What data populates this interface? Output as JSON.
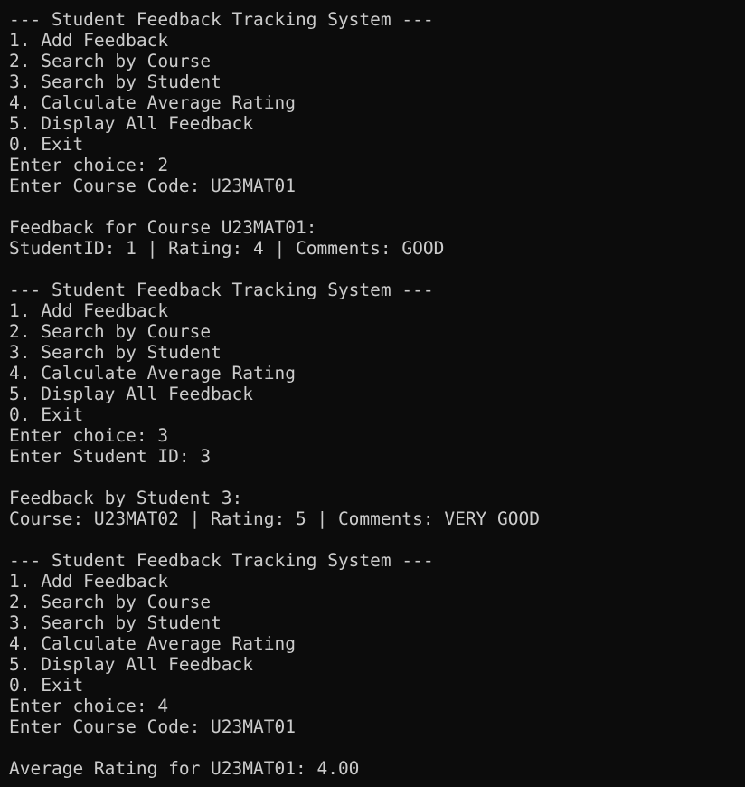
{
  "terminal": {
    "lines": [
      "--- Student Feedback Tracking System ---",
      "1. Add Feedback",
      "2. Search by Course",
      "3. Search by Student",
      "4. Calculate Average Rating",
      "5. Display All Feedback",
      "0. Exit",
      "Enter choice: 2",
      "Enter Course Code: U23MAT01",
      "",
      "Feedback for Course U23MAT01:",
      "StudentID: 1 | Rating: 4 | Comments: GOOD",
      "",
      "--- Student Feedback Tracking System ---",
      "1. Add Feedback",
      "2. Search by Course",
      "3. Search by Student",
      "4. Calculate Average Rating",
      "5. Display All Feedback",
      "0. Exit",
      "Enter choice: 3",
      "Enter Student ID: 3",
      "",
      "Feedback by Student 3:",
      "Course: U23MAT02 | Rating: 5 | Comments: VERY GOOD",
      "",
      "--- Student Feedback Tracking System ---",
      "1. Add Feedback",
      "2. Search by Course",
      "3. Search by Student",
      "4. Calculate Average Rating",
      "5. Display All Feedback",
      "0. Exit",
      "Enter choice: 4",
      "Enter Course Code: U23MAT01",
      "",
      "Average Rating for U23MAT01: 4.00"
    ],
    "colors": {
      "background": "#0c0c0c",
      "foreground": "#cccccc"
    }
  }
}
